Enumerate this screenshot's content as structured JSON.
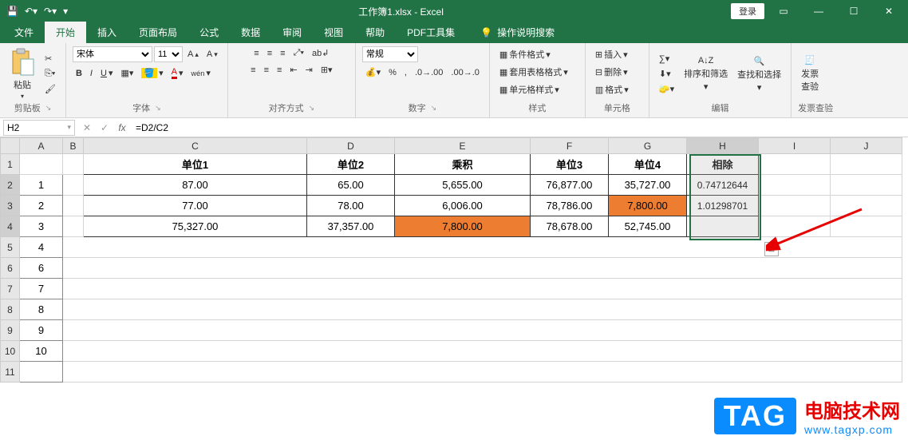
{
  "title": "工作簿1.xlsx - Excel",
  "login": "登录",
  "tabs": [
    "文件",
    "开始",
    "插入",
    "页面布局",
    "公式",
    "数据",
    "审阅",
    "视图",
    "帮助",
    "PDF工具集"
  ],
  "tell_me": "操作说明搜索",
  "ribbon": {
    "clipboard": {
      "paste": "粘贴",
      "label": "剪贴板"
    },
    "font": {
      "name": "宋体",
      "size": "11",
      "label": "字体"
    },
    "align": {
      "label": "对齐方式"
    },
    "number": {
      "fmt": "常规",
      "label": "数字"
    },
    "styles": {
      "cond": "条件格式",
      "tbl": "套用表格格式",
      "cell": "单元格样式",
      "label": "样式"
    },
    "cells": {
      "insert": "插入",
      "delete": "删除",
      "format": "格式",
      "label": "单元格"
    },
    "editing": {
      "sort": "排序和筛选",
      "find": "查找和选择",
      "label": "编辑"
    },
    "invoice": {
      "btn": "发票\n查验",
      "label": "发票查验"
    }
  },
  "namebox": "H2",
  "formula": "=D2/C2",
  "cols": {
    "A": 54,
    "B": 26,
    "C": 280,
    "D": 110,
    "E": 170,
    "F": 98,
    "G": 98,
    "H": 90,
    "I": 90,
    "J": 90
  },
  "headers": {
    "C": "单位1",
    "D": "单位2",
    "E": "乘积",
    "F": "单位3",
    "G": "单位4",
    "H": "相除"
  },
  "rows": [
    {
      "A": "1",
      "C": "87.00",
      "D": "65.00",
      "E": "5,655.00",
      "F": "76,877.00",
      "G": "35,727.00",
      "H": "0.74712644"
    },
    {
      "A": "2",
      "C": "77.00",
      "D": "78.00",
      "E": "6,006.00",
      "F": "78,786.00",
      "G": "7,800.00",
      "Gorange": true,
      "H": "1.01298701"
    },
    {
      "A": "3",
      "C": "75,327.00",
      "D": "37,357.00",
      "E": "7,800.00",
      "Eorange": true,
      "F": "78,678.00",
      "G": "52,745.00",
      "H": ""
    }
  ],
  "watermark": {
    "tag": "TAG",
    "line1": "电脑技术网",
    "line2": "www.tagxp.com"
  }
}
